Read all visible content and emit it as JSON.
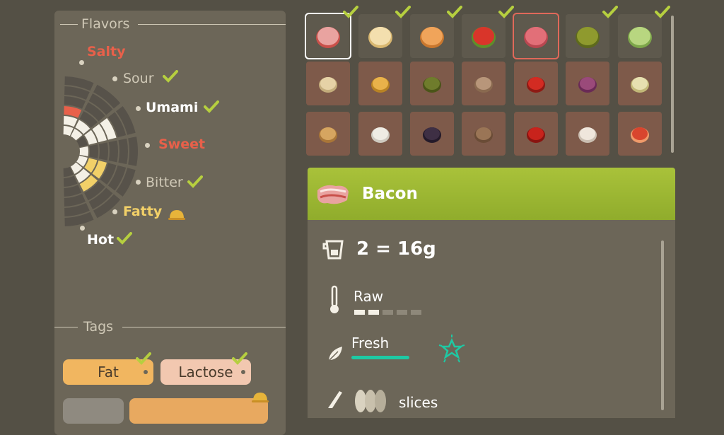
{
  "flavors": {
    "title": "Flavors",
    "items": [
      {
        "label": "Salty",
        "style": "red",
        "badge": "none"
      },
      {
        "label": "Sour",
        "style": "dim",
        "badge": "check-icon"
      },
      {
        "label": "Umami",
        "style": "white",
        "badge": "check-icon"
      },
      {
        "label": "Sweet",
        "style": "red",
        "badge": "none"
      },
      {
        "label": "Bitter",
        "style": "dim",
        "badge": "check-icon"
      },
      {
        "label": "Fatty",
        "style": "yellow",
        "badge": "helmet-icon"
      },
      {
        "label": "Hot",
        "style": "white",
        "badge": "check-icon"
      }
    ]
  },
  "tags": {
    "title": "Tags",
    "items": [
      {
        "label": "Fat",
        "checked": true
      },
      {
        "label": "Lactose",
        "checked": true
      }
    ]
  },
  "ingredients": {
    "row1": [
      "bacon-icon",
      "bun-bottom-icon",
      "bun-top-icon",
      "tomato-icon",
      "salami-icon",
      "pickle-icon",
      "lettuce-icon"
    ],
    "row2": [
      "bread-dough-icon",
      "honey-icon",
      "olive-icon",
      "mushroom-icon",
      "red-pepper-icon",
      "red-onion-icon",
      "onion-icon"
    ],
    "row3": [
      "cheese-block-icon",
      "mozzarella-icon",
      "black-olive-icon",
      "shiitake-icon",
      "ketchup-icon",
      "garlic-icon",
      "tomato-slice-icon"
    ]
  },
  "detail": {
    "name": "Bacon",
    "portion": "2 = 16g",
    "state": "Raw",
    "freshness": "Fresh",
    "cut": "slices"
  },
  "colors": {
    "accent_green": "#a9c23a",
    "check_green": "#b6cf3f",
    "fresh_teal": "#1ec9a4",
    "flavor_red": "#e8604a",
    "flavor_yellow": "#f2d068"
  }
}
